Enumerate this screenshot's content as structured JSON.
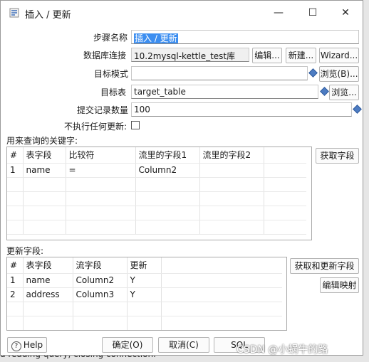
{
  "dialog": {
    "title": "插入 / 更新",
    "window_buttons": {
      "minimize": "—",
      "maximize": "☐",
      "close": "✕"
    }
  },
  "form": {
    "step_name": {
      "label": "步骤名称",
      "value": "插入 / 更新"
    },
    "db_connection": {
      "label": "数据库连接",
      "value": "10.2mysql-kettle_test库",
      "edit_label": "编辑...",
      "new_label": "新建...",
      "wizard_label": "Wizard..."
    },
    "target_schema": {
      "label": "目标模式",
      "value": "",
      "browse_label": "浏览(B)..."
    },
    "target_table": {
      "label": "目标表",
      "value": "target_table",
      "browse_label": "浏览..."
    },
    "commit_size": {
      "label": "提交记录数量",
      "value": "100"
    },
    "no_update": {
      "label": "不执行任何更新:",
      "checked": false
    }
  },
  "key_section": {
    "label": "用来查询的关键字:",
    "get_fields_label": "获取字段",
    "headers": [
      "#",
      "表字段",
      "比较符",
      "流里的字段1",
      "流里的字段2"
    ],
    "rows": [
      [
        "1",
        "name",
        "=",
        "Column2",
        ""
      ]
    ]
  },
  "update_section": {
    "label": "更新字段:",
    "get_update_fields_label": "获取和更新字段",
    "edit_mapping_label": "编辑映射",
    "headers": [
      "#",
      "表字段",
      "流字段",
      "更新"
    ],
    "rows": [
      [
        "1",
        "name",
        "Column2",
        "Y"
      ],
      [
        "2",
        "address",
        "Column3",
        "Y"
      ]
    ]
  },
  "footer": {
    "help_label": "Help",
    "ok_label": "确定(O)",
    "cancel_label": "取消(C)",
    "sql_label": "SQL"
  },
  "background": {
    "log_line": "d reading query, closing connection."
  },
  "watermark": "CSDN @小蜗牛的路"
}
